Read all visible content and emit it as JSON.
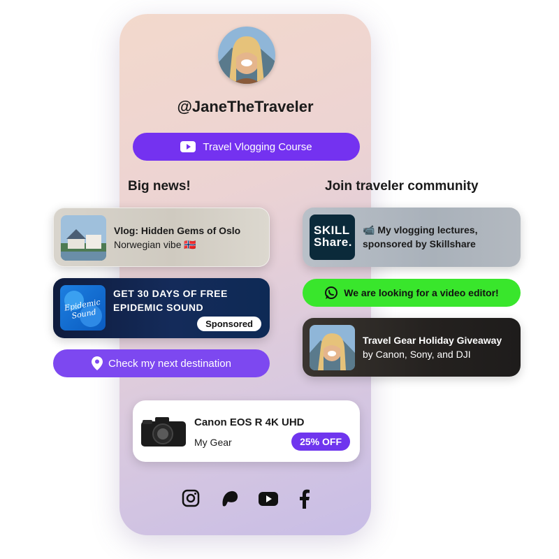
{
  "profile": {
    "username": "@JaneTheTraveler"
  },
  "course_button": {
    "label": "Travel Vlogging Course",
    "icon": "youtube-icon"
  },
  "sections": {
    "left_heading": "Big news!",
    "right_heading": "Join traveler community"
  },
  "cards": {
    "oslo": {
      "title": "Vlog: Hidden Gems of Oslo",
      "subtitle": "Norwegian vibe 🇳🇴"
    },
    "epidemic": {
      "line1": "GET 30 DAYS OF FREE",
      "line2": "EPIDEMIC SOUND",
      "badge": "Sponsored",
      "logo_text": "Epidemic Sound"
    },
    "skillshare": {
      "line1": "📹 My vlogging lectures,",
      "line2": "sponsored by Skillshare",
      "logo_line1": "SKILL",
      "logo_line2": "Share."
    },
    "giveaway": {
      "title": "Travel Gear Holiday Giveaway",
      "subtitle": "by Canon, Sony, and DJI"
    }
  },
  "destination_button": {
    "label": "Check my next destination",
    "icon": "location-pin-icon"
  },
  "whatsapp_button": {
    "label": "We are looking for a video editor!",
    "icon": "whatsapp-icon"
  },
  "gear_card": {
    "title": "Canon EOS R 4K UHD",
    "subtitle": "My Gear",
    "badge": "25% OFF"
  },
  "social_icons": [
    "instagram-icon",
    "patreon-icon",
    "youtube-icon",
    "facebook-icon"
  ],
  "colors": {
    "accent_purple": "#7432f0",
    "whatsapp_green": "#39e62c"
  }
}
